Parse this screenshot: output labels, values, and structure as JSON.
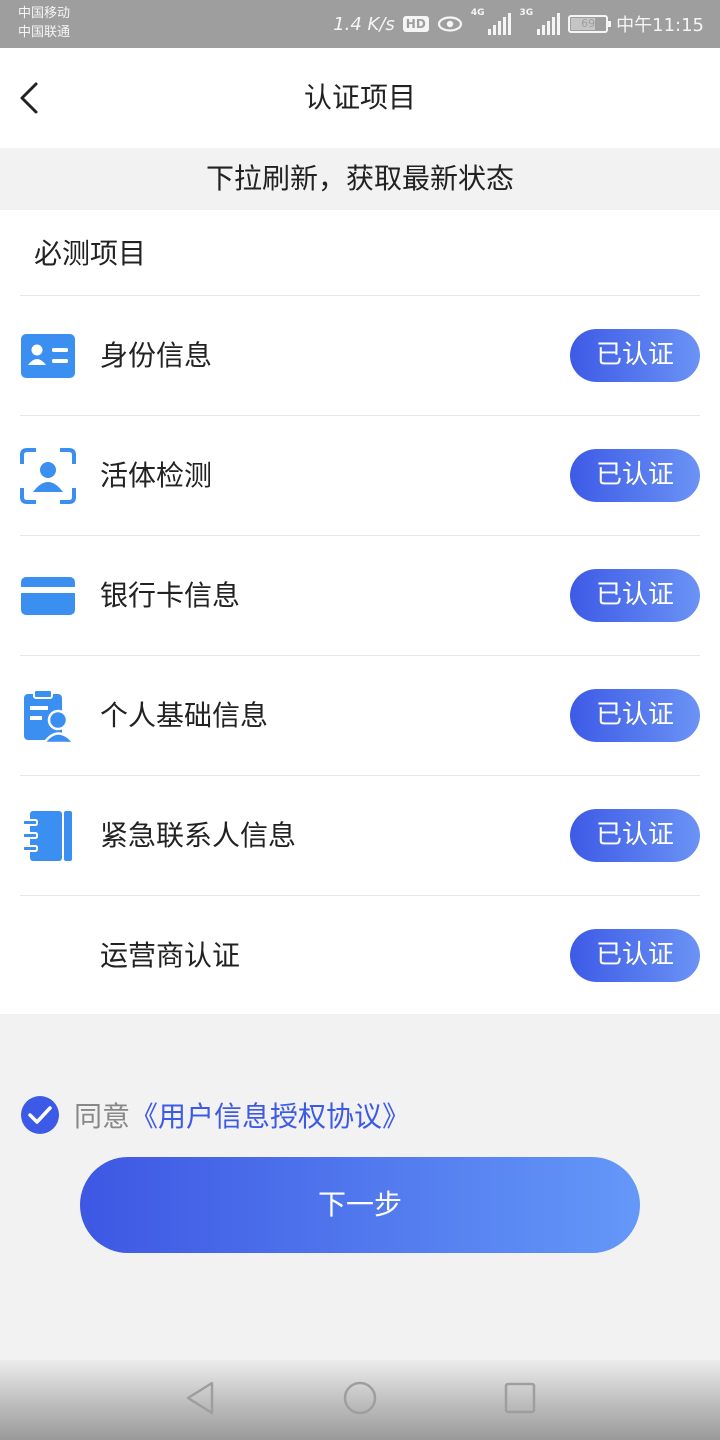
{
  "status_bar": {
    "carrier_1": "中国移动",
    "carrier_2": "中国联通",
    "speed": "1.4 K/s",
    "hd": "HD",
    "net_4g": "4G",
    "net_3g": "3G",
    "battery": "69",
    "battery_level": 0.69,
    "time": "中午11:15"
  },
  "header": {
    "title": "认证项目",
    "back_icon": "chevron-left-icon"
  },
  "refresh_hint": "下拉刷新，获取最新状态",
  "section": {
    "title": "必测项目",
    "items": [
      {
        "label": "身份信息",
        "status": "已认证",
        "icon": "id-card-icon"
      },
      {
        "label": "活体检测",
        "status": "已认证",
        "icon": "face-scan-icon"
      },
      {
        "label": "银行卡信息",
        "status": "已认证",
        "icon": "bank-card-icon"
      },
      {
        "label": "个人基础信息",
        "status": "已认证",
        "icon": "personal-info-icon"
      },
      {
        "label": "紧急联系人信息",
        "status": "已认证",
        "icon": "contact-book-icon"
      },
      {
        "label": "运营商认证",
        "status": "已认证",
        "icon": ""
      }
    ]
  },
  "agreement": {
    "prefix": "同意",
    "link": "《用户信息授权协议》",
    "checked": true
  },
  "next_button": "下一步",
  "colors": {
    "accent": "#3d5ae6",
    "accent_light": "#6b93f5",
    "icon_blue": "#3b8ff0"
  }
}
